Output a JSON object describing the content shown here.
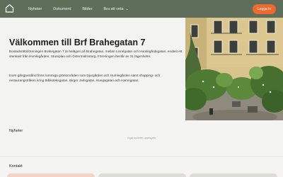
{
  "nav": {
    "links": [
      {
        "label": "Nyheter"
      },
      {
        "label": "Dokument"
      },
      {
        "label": "Bilder"
      },
      {
        "label": "Bra att veta"
      }
    ],
    "login_label": "Logga in",
    "colors": {
      "bar": "#5e6e5b",
      "accent": "#ee6a2e"
    }
  },
  "hero": {
    "title": "Välkommen till Brf Brahegatan 7",
    "paragraph_1": "Bostadsrättsföreningen Brahegatan 7 är belägen på Brahegatan, mellan Linnégatan och Humlegårdsgatan, endast ett stenkast från Humlegården, Stureplan och Östermalmstorg. Föreningen består av 31 lägenheter.",
    "paragraph_2": "Inom gångavstånd finns lummiga grönområden som Djurgården och Humlegården samt shopping- och restaurangstråken kring Biblioteksgatan, Birger Jarlsgatan, Kungsgatan och Hamngatan."
  },
  "news": {
    "title": "Nyheter",
    "empty_text": "Inga nyheter upplagda"
  },
  "contact": {
    "title": "Kontakt"
  }
}
